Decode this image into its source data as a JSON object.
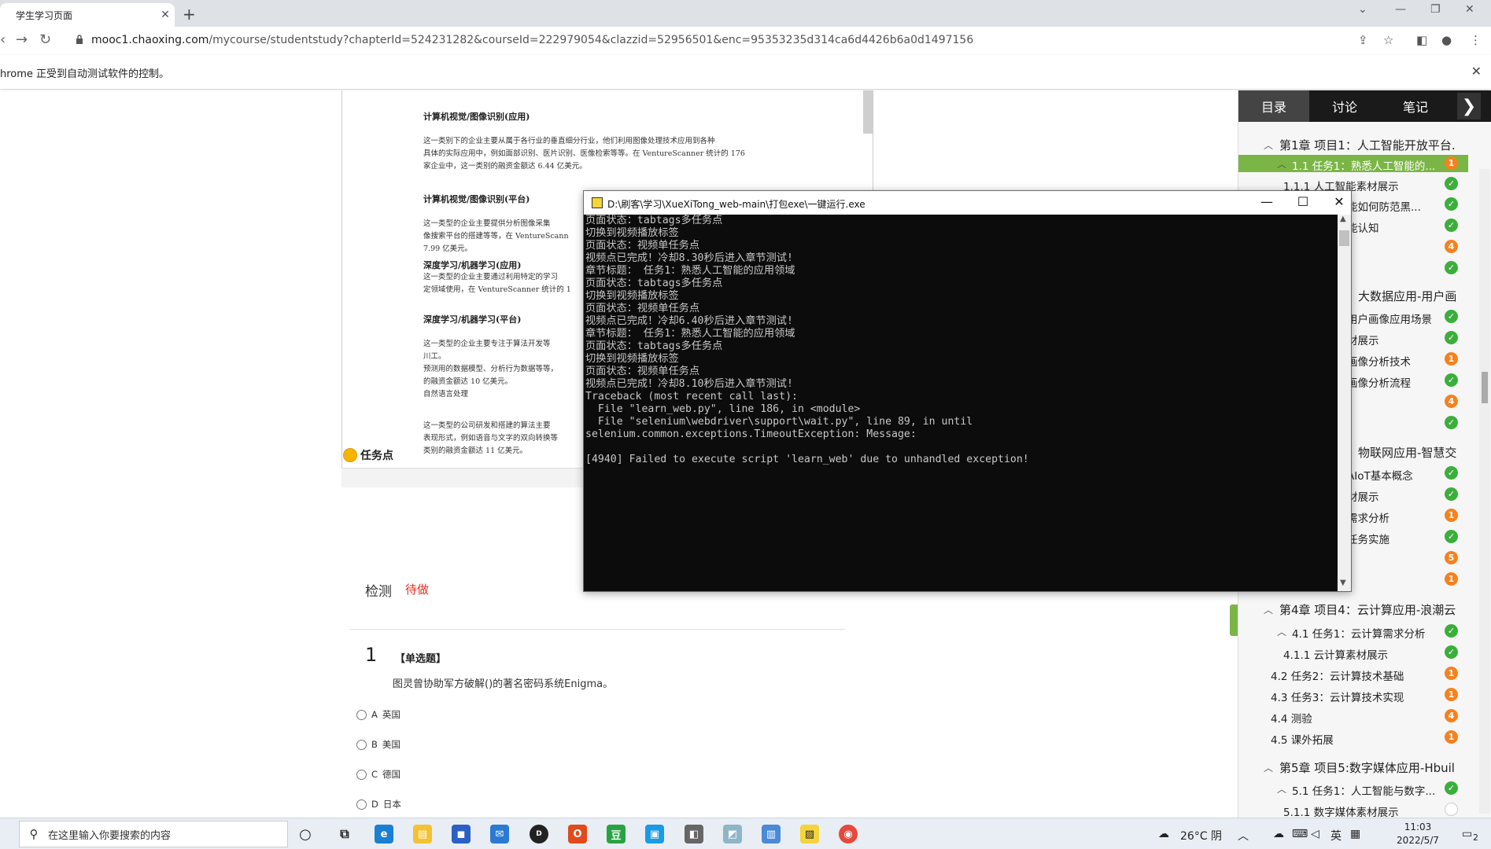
{
  "browser": {
    "tab_title": "学生学习页面",
    "tab_close": "✕",
    "new_tab": "+",
    "url_host": "mooc1.chaoxing.com",
    "url_path": "/mycourse/studentstudy?chapterId=524231282&courseId=222979054&clazzid=52956501&enc=95353235d314ca6d4426b6a0d1497156",
    "infobar": "hrome 正受到自动测试软件的控制。",
    "infobar_close": "✕"
  },
  "document": {
    "h1": "计算机视觉/图像识别(应用)",
    "p1": [
      "这一类别下的企业主要从属于各行业的垂直细分行业，他们利用图像处理技术应用到各种",
      "具体的实际应用中，例如面部识别、医片识别、医像检索等等。在 VentureScanner 统计的 176",
      "家企业中，这一类别的融资金额达 6.44 亿美元。"
    ],
    "h2": "计算机视觉/图像识别(平台)",
    "p2": [
      "这一类型的企业主要提供分析图像采集",
      "像搜索平台的搭建等等，在 VentureScann",
      "7.99 亿美元。"
    ],
    "h3": "深度学习/机器学习(应用)",
    "p3": [
      "这一类型的企业主要通过利用特定的学习",
      "定领域使用，在 VentureScanner 统计的 1"
    ],
    "h4": "深度学习/机器学习(平台)",
    "p4": [
      "这一类型的企业主要专注于算法开发等",
      "川工。",
      "预测用的数据模型、分析行为数据等等，",
      "的融资金额达 10 亿美元。",
      "自然语言处理"
    ],
    "p5": [
      "这一类型的公司研发和搭建的算法主要",
      "表现形式，例如语音与文字的双向转换等",
      "类别的融资金额达 11 亿美元。"
    ]
  },
  "task": {
    "title": "任务点",
    "detect_label": "检测",
    "detect_status": "待做",
    "question_number": "1",
    "question_type": "【单选题】",
    "question_text": "图灵曾协助军方破解()的著名密码系统Enigma。",
    "options": [
      {
        "letter": "A",
        "text": "英国"
      },
      {
        "letter": "B",
        "text": "美国"
      },
      {
        "letter": "C",
        "text": "德国"
      },
      {
        "letter": "D",
        "text": "日本"
      }
    ]
  },
  "sidebar": {
    "tabs": [
      "目录",
      "讨论",
      "笔记"
    ],
    "arrow": "❯",
    "items": [
      {
        "label": "第1章 项目1：人工智能开放平台.",
        "kind": "chapter",
        "caret": "︿",
        "badge": ""
      },
      {
        "label": "1.1 任务1：熟悉人工智能的...",
        "kind": "hl",
        "caret": "︿",
        "badge": "1",
        "state": "todo"
      },
      {
        "label": "1.1.1 人工智能素材展示",
        "kind": "sub",
        "badge": "✓",
        "state": "done"
      },
      {
        "label": "能如何防范黑...",
        "kind": "frag",
        "badge": "✓",
        "state": "done"
      },
      {
        "label": "能认知",
        "kind": "frag",
        "badge": "✓",
        "state": "done"
      },
      {
        "label": "",
        "kind": "frag",
        "badge": "4",
        "state": "todo"
      },
      {
        "label": "",
        "kind": "frag",
        "badge": "✓",
        "state": "done"
      },
      {
        "label": "大数据应用-用户画",
        "kind": "frag-ch",
        "badge": ""
      },
      {
        "label": "用户画像应用场景",
        "kind": "frag",
        "badge": "✓",
        "state": "done"
      },
      {
        "label": "材展示",
        "kind": "frag",
        "badge": "✓",
        "state": "done"
      },
      {
        "label": "画像分析技术",
        "kind": "frag",
        "badge": "1",
        "state": "todo"
      },
      {
        "label": "画像分析流程",
        "kind": "frag",
        "badge": "✓",
        "state": "done"
      },
      {
        "label": "",
        "kind": "frag",
        "badge": "4",
        "state": "todo"
      },
      {
        "label": "",
        "kind": "frag",
        "badge": "✓",
        "state": "done"
      },
      {
        "label": "物联网应用-智慧交",
        "kind": "frag-ch",
        "badge": ""
      },
      {
        "label": "AIoT基本概念",
        "kind": "frag",
        "badge": "✓",
        "state": "done"
      },
      {
        "label": "材展示",
        "kind": "frag",
        "badge": "✓",
        "state": "done"
      },
      {
        "label": "需求分析",
        "kind": "frag",
        "badge": "1",
        "state": "todo"
      },
      {
        "label": "任务实施",
        "kind": "frag",
        "badge": "✓",
        "state": "done"
      },
      {
        "label": "",
        "kind": "frag",
        "badge": "5",
        "state": "todo"
      },
      {
        "label": "",
        "kind": "frag",
        "badge": "1",
        "state": "todo"
      },
      {
        "label": "第4章 项目4：云计算应用-浪潮云",
        "kind": "chapter",
        "caret": "︿",
        "badge": ""
      },
      {
        "label": "4.1 任务1：云计算需求分析",
        "kind": "sec",
        "caret": "︿",
        "badge": "✓",
        "state": "done"
      },
      {
        "label": "4.1.1 云计算素材展示",
        "kind": "sub",
        "badge": "✓",
        "state": "done"
      },
      {
        "label": "4.2 任务2：云计算技术基础",
        "kind": "sec2",
        "badge": "1",
        "state": "todo"
      },
      {
        "label": "4.3 任务3：云计算技术实现",
        "kind": "sec2",
        "badge": "1",
        "state": "todo"
      },
      {
        "label": "4.4 测验",
        "kind": "sec2",
        "badge": "4",
        "state": "todo"
      },
      {
        "label": "4.5 课外拓展",
        "kind": "sec2",
        "badge": "1",
        "state": "todo"
      },
      {
        "label": "第5章 项目5:数字媒体应用-Hbuil",
        "kind": "chapter",
        "caret": "︿",
        "badge": ""
      },
      {
        "label": "5.1 任务1：人工智能与数字...",
        "kind": "sec",
        "caret": "︿",
        "badge": "✓",
        "state": "done"
      },
      {
        "label": "5.1.1 数字媒体素材展示",
        "kind": "sub",
        "badge": "",
        "state": "empty"
      }
    ]
  },
  "console": {
    "title": "D:\\刷客\\学习\\XueXiTong_web-main\\打包exe\\一键运行.exe",
    "lines": [
      "页面状态：tabtags多任务点",
      "切换到视频播放标签",
      "页面状态：视频单任务点",
      "视频点已完成！冷却8.30秒后进入章节测试!",
      "章节标题： 任务1：熟悉人工智能的应用领域",
      "页面状态：tabtags多任务点",
      "切换到视频播放标签",
      "页面状态：视频单任务点",
      "视频点已完成！冷却6.40秒后进入章节测试!",
      "章节标题： 任务1：熟悉人工智能的应用领域",
      "页面状态：tabtags多任务点",
      "切换到视频播放标签",
      "页面状态：视频单任务点",
      "视频点已完成！冷却8.10秒后进入章节测试!",
      "Traceback (most recent call last):",
      "  File \"learn_web.py\", line 186, in <module>",
      "  File \"selenium\\webdriver\\support\\wait.py\", line 89, in until",
      "selenium.common.exceptions.TimeoutException: Message:",
      "",
      "[4940] Failed to execute script 'learn_web' due to unhandled exception!"
    ]
  },
  "taskbar": {
    "search_placeholder": "在这里输入你要搜索的内容",
    "weather": "26°C 阴",
    "lang": "英",
    "time": "11:03",
    "date": "2022/5/7",
    "notif": "2"
  },
  "colors": {
    "sidebar_highlight": "#7bb546",
    "badge_done": "#3cae3c",
    "badge_todo": "#f5811f",
    "status_red": "#e0301e",
    "console_bg": "#0c0c0c"
  }
}
